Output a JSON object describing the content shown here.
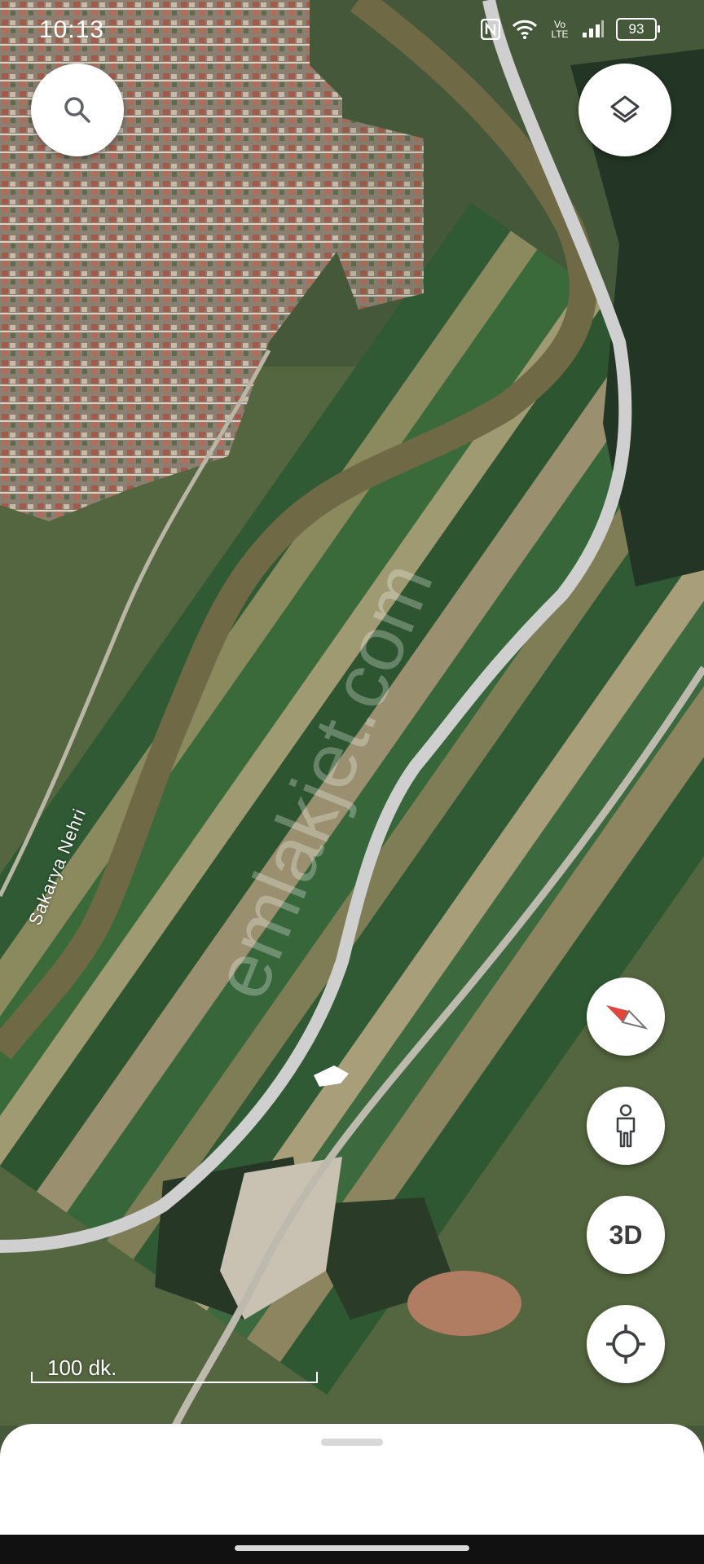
{
  "status_bar": {
    "time": "10:13",
    "battery": "93",
    "signal_text": "Vo LTE",
    "icons": [
      "nfc-icon",
      "wifi-icon",
      "volte-icon",
      "signal-icon",
      "battery-icon"
    ]
  },
  "map": {
    "type": "satellite",
    "river_label": "Sakarya Nehri",
    "watermark": "emlakjet.com",
    "scale_label": "100 dk."
  },
  "controls": {
    "search_icon": "search-icon",
    "layers_icon": "layers-icon",
    "compass_icon": "compass-icon",
    "street_view_icon": "pegman-icon",
    "three_d_label": "3D",
    "location_icon": "my-location-icon"
  },
  "colors": {
    "field_dark": "#2f5a34",
    "field_light": "#8a8a5e",
    "river": "#6f6a45",
    "road": "#cfcfcf",
    "compass_red": "#e0463c"
  }
}
